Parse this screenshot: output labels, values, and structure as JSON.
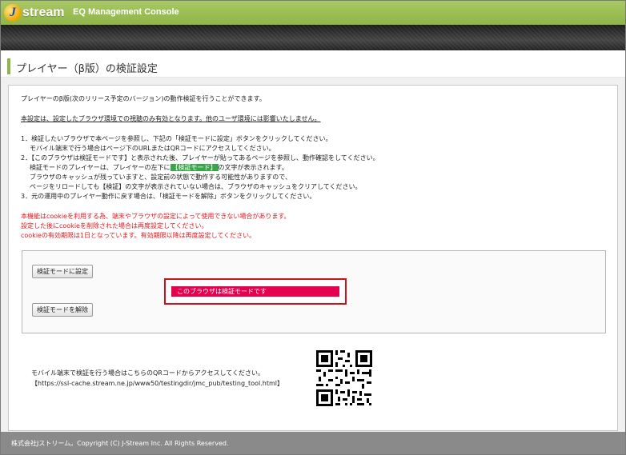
{
  "header": {
    "logo_j": "J",
    "logo_text": "stream",
    "app_title": "EQ Management Console"
  },
  "page_title": "プレイヤー（β版）の検証設定",
  "intro": {
    "line1": "プレイヤーのβ版(次のリリース予定のバージョン)の動作検証を行うことができます。",
    "line2": "本設定は、設定したブラウザ環境での視聴のみ有効となります。他のユーザ環境には影響いたしません。"
  },
  "steps": {
    "s1a": "1．検証したいブラウザで本ページを参照し、下記の「検証モードに設定」ボタンをクリックしてください。",
    "s1b": "モバイル端末で行う場合はページ下のURLまたはQRコードにアクセスしてください。",
    "s2a": "2．【このブラウザは検証モードです】と表示された後、プレイヤーが貼ってあるページを参照し、動作確認をしてください。",
    "s2b_pre": "検証モードのプレイヤーは、プレイヤーの左下に",
    "s2b_hl": "【検証モード】",
    "s2b_post": "の文字が表示されます。",
    "s2c": "ブラウザのキャッシュが残っていますと、設定前の状態で動作する可能性がありますので、",
    "s2d": "ページをリロードしても【検証】の文字が表示されていない場合は、ブラウザのキャッシュをクリアしてください。",
    "s3": "3．元の運用中のプレイヤー動作に戻す場合は、「検証モードを解除」ボタンをクリックしてください。"
  },
  "notes": {
    "n1": "本機能はcookieを利用する為、端末やブラウザの設定によって使用できない場合があります。",
    "n2": "設定した後にcookieを削除された場合は再度設定してください。",
    "n3": "cookieの有効期限は1日となっています。有効期限以降は再度設定してください。"
  },
  "buttons": {
    "set": "検証モードに設定",
    "unset": "検証モードを解除"
  },
  "status": "このブラウザは検証モードです",
  "mobile": {
    "text": "モバイル端末で検証を行う場合はこちらのQRコードからアクセスしてください。",
    "url": "【https://ssl-cache.stream.ne.jp/www50/testingdir/jmc_pub/testing_tool.html】"
  },
  "footer": "株式会社Jストリーム。Copyright (C) J-Stream Inc. All Rights Reserved.",
  "colors": {
    "header_green": "#8fb548",
    "status_pink": "#e5004f",
    "note_red": "#e8151b",
    "highlight_green": "#3aa64a"
  }
}
